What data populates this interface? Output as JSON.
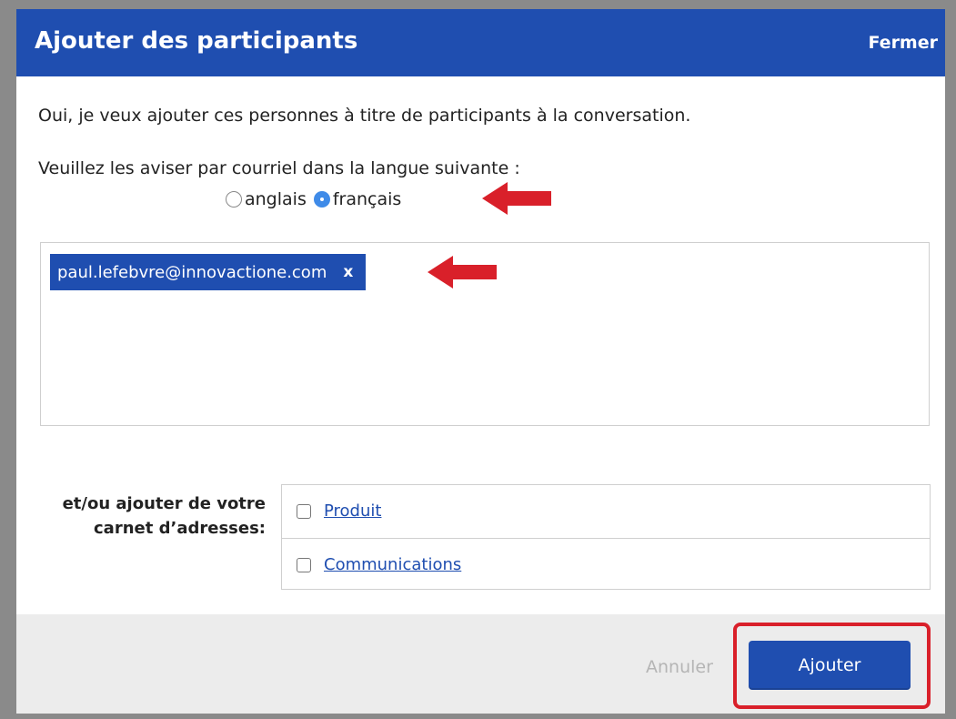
{
  "dialog": {
    "title": "Ajouter des participants",
    "close_label": "Fermer"
  },
  "intro_text": "Oui, je veux ajouter ces personnes à titre de participants à la conversation.",
  "language": {
    "prompt": "Veuillez les aviser par courriel dans la langue suivante :",
    "options": [
      {
        "label": "anglais",
        "selected": false
      },
      {
        "label": "français",
        "selected": true
      }
    ]
  },
  "recipients": [
    {
      "email": "paul.lefebvre@innovactione.com",
      "remove_label": "x"
    }
  ],
  "address_book": {
    "label_line1": "et/ou ajouter de votre",
    "label_line2": "carnet d’adresses:",
    "groups": [
      {
        "label": "Produit",
        "checked": false
      },
      {
        "label": "Communications",
        "checked": false
      }
    ]
  },
  "footer": {
    "cancel_label": "Annuler",
    "add_label": "Ajouter"
  },
  "colors": {
    "header": "#1f4eb0",
    "accent": "#3f8be8",
    "annotation_red": "#d9202a"
  }
}
